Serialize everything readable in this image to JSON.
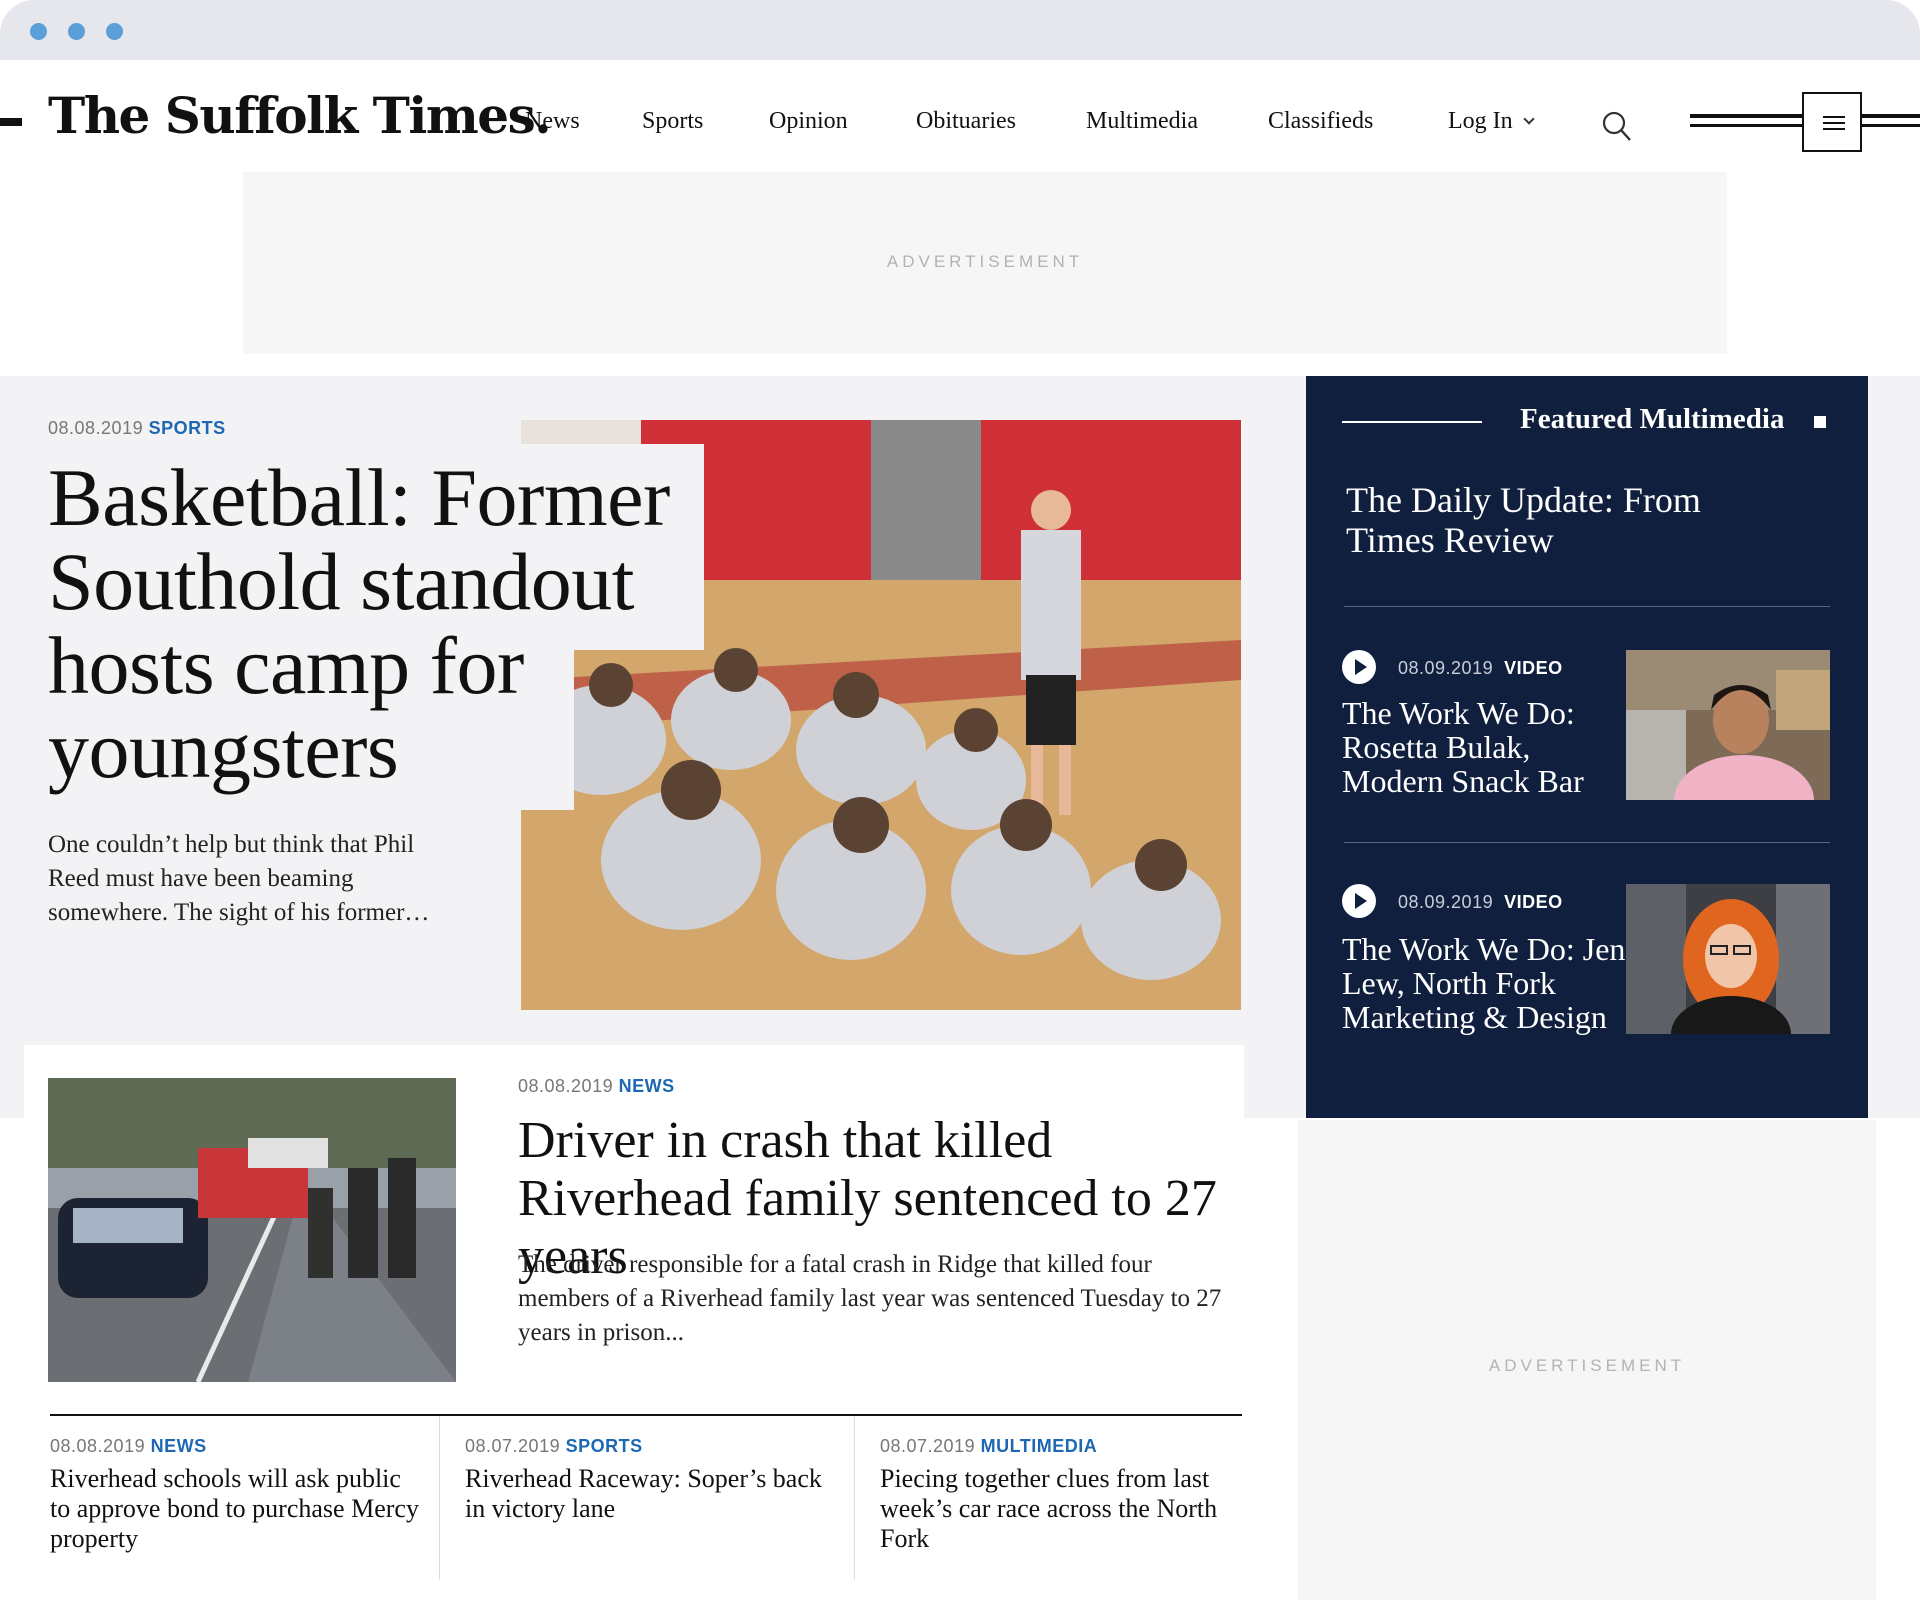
{
  "browser": {
    "dots": [
      "dot",
      "dot",
      "dot"
    ]
  },
  "header": {
    "logo": "The Suffolk Times.",
    "nav": [
      "News",
      "Sports",
      "Opinion",
      "Obituaries",
      "Multimedia",
      "Classifieds"
    ],
    "login_label": "Log In",
    "icons": {
      "search": "search-icon",
      "menu": "menu-icon",
      "login_dropdown": "chevron-down-icon"
    }
  },
  "ads": {
    "top_label": "ADVERTISEMENT",
    "side_label": "ADVERTISEMENT"
  },
  "hero": {
    "date": "08.08.2019",
    "category": "SPORTS",
    "title": "Basketball: Former Southold standout hosts camp for youngsters",
    "dek": "One couldn’t help but think that Phil Reed must have been beaming somewhere. The sight of his former…"
  },
  "story2": {
    "date": "08.08.2019",
    "category": "NEWS",
    "title": "Driver in crash that killed Riverhead family sentenced to 27 years",
    "dek": "The driver responsible for a fatal crash in Ridge that killed four members of a Riverhead family last year was sentenced Tuesday to 27 years in prison..."
  },
  "sub_stories": [
    {
      "date": "08.08.2019",
      "category": "NEWS",
      "title": "Riverhead schools will ask public to approve bond to purchase Mercy property"
    },
    {
      "date": "08.07.2019",
      "category": "SPORTS",
      "title": "Riverhead Raceway: Soper’s back in victory lane"
    },
    {
      "date": "08.07.2019",
      "category": "MULTIMEDIA",
      "title": "Piecing together clues from last week’s car race across the North Fork"
    }
  ],
  "featured": {
    "heading": "Featured Multimedia",
    "lead_title": "The Daily Update: From Times Review",
    "videos": [
      {
        "date": "08.09.2019",
        "category": "VIDEO",
        "title": "The Work We Do: Rosetta Bulak, Modern Snack Bar"
      },
      {
        "date": "08.09.2019",
        "category": "VIDEO",
        "title": "The Work We Do: Jen Lew, North Fork Marketing & Design"
      }
    ]
  },
  "colors": {
    "navy": "#0f1f3d",
    "category_blue": "#1d67b3",
    "chrome_dots": "#5b9fd8",
    "page_grey": "#f3f3f5"
  }
}
